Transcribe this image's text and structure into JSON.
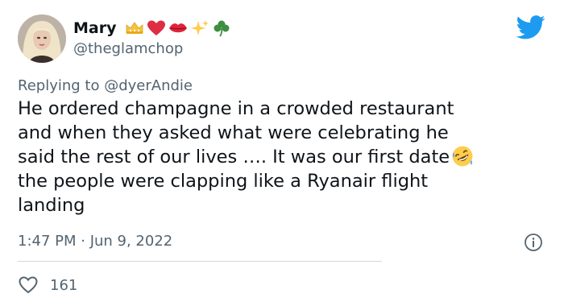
{
  "author": {
    "display_name": "Mary",
    "handle": "@theglamchop",
    "name_emojis": [
      "crown-icon",
      "red-heart-icon",
      "kiss-lips-icon",
      "sparkles-icon",
      "shamrock-icon"
    ]
  },
  "reply": {
    "prefix": "Replying to",
    "target": "@dyerAndie"
  },
  "tweet": {
    "lines": [
      "He ordered champagne in a crowded restaurant",
      "and when they asked what were celebrating he",
      "said the rest of our lives …. It was our first date",
      " the people were clapping like a Ryanair flight",
      "landing"
    ],
    "inline_emoji": "rolling-on-floor-laughing-icon"
  },
  "meta": {
    "timestamp": "1:47 PM · Jun 9, 2022"
  },
  "stats": {
    "likes": "161"
  },
  "colors": {
    "twitter_blue": "#1d9bf0",
    "secondary_text": "#536471",
    "primary_text": "#0f1419",
    "divider": "#cfd9de"
  }
}
